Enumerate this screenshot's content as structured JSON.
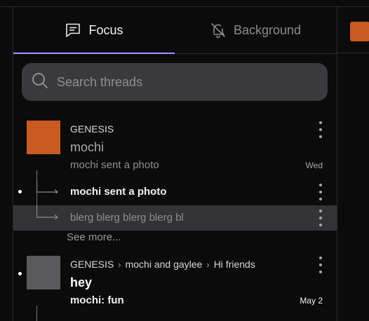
{
  "tabs": [
    {
      "label": "Focus",
      "icon": "message-square-icon",
      "active": true
    },
    {
      "label": "Background",
      "icon": "bell-off-icon",
      "active": false
    }
  ],
  "search": {
    "placeholder": "Search threads"
  },
  "colors": {
    "accent": "#a694ff",
    "avatar_orange": "#c95a22",
    "avatar_gray": "#5a5a5c",
    "highlight_row": "#333336"
  },
  "threads": [
    {
      "crumbs": [
        "GENESIS"
      ],
      "title": "mochi",
      "preview": "mochi sent a photo",
      "date": "Wed",
      "replies": [
        {
          "text": "mochi sent a photo",
          "unread": true
        },
        {
          "text": "blerg blerg blerg blerg bl",
          "unread": false
        }
      ],
      "see_more": "See more..."
    },
    {
      "crumbs": [
        "GENESIS",
        "mochi and gaylee",
        "Hi friends"
      ],
      "title": "hey",
      "preview": "mochi: fun",
      "date": "May 2",
      "unread": true
    }
  ]
}
